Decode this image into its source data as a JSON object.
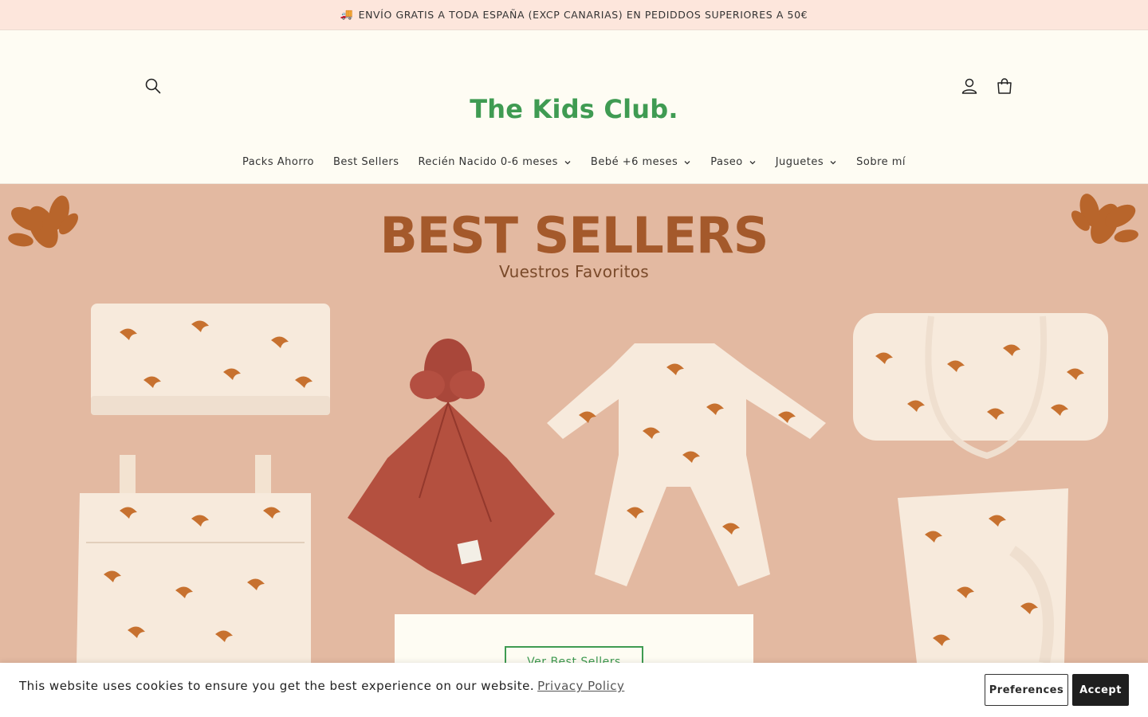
{
  "announcement": {
    "icon": "truck-icon",
    "text": "ENVÍO GRATIS A TODA ESPAÑA (EXCP CANARIAS) EN PEDIDDOS SUPERIORES A 50€"
  },
  "header": {
    "logo": "The Kids Club.",
    "icons": [
      "search-icon",
      "account-icon",
      "cart-icon"
    ]
  },
  "nav": {
    "items": [
      {
        "label": "Packs Ahorro",
        "dropdown": false
      },
      {
        "label": "Best Sellers",
        "dropdown": false
      },
      {
        "label": "Recién Nacido 0-6 meses",
        "dropdown": true
      },
      {
        "label": "Bebé +6 meses",
        "dropdown": true
      },
      {
        "label": "Paseo",
        "dropdown": true
      },
      {
        "label": "Juguetes",
        "dropdown": true
      },
      {
        "label": "Sobre mí",
        "dropdown": false
      }
    ]
  },
  "hero": {
    "title": "BEST SELLERS",
    "subtitle": "Vuestros Favoritos",
    "cta": "Ver Best Sellers",
    "colors": {
      "background": "#e3b9a1",
      "title": "#a4592b",
      "accent": "#3f9b52"
    }
  },
  "cookie": {
    "text": "This website uses cookies to ensure you get the best experience on our website.",
    "link": "Privacy Policy",
    "preferences": "Preferences",
    "accept": "Accept"
  }
}
